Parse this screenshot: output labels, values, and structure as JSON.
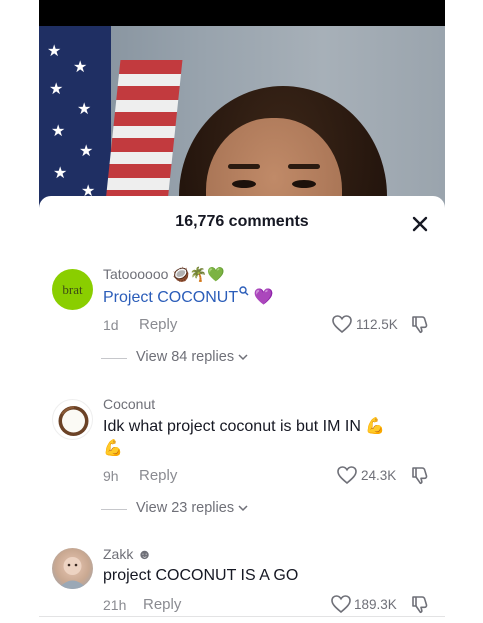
{
  "sheet": {
    "title": "16,776 comments"
  },
  "comments": [
    {
      "username": "Tatoooooo",
      "username_emoji": "🥥🌴💚",
      "text": "Project COCONUT",
      "text_suffix": "💜",
      "avatar_text": "brat",
      "age": "1d",
      "reply_label": "Reply",
      "likes": "112.5K",
      "view_replies": "View 84 replies"
    },
    {
      "username": "Coconut",
      "text_line1": "Idk what project coconut is but IM IN 💪",
      "text_line2": "💪",
      "age": "9h",
      "reply_label": "Reply",
      "likes": "24.3K",
      "view_replies": "View 23 replies"
    },
    {
      "username": "Zakk",
      "username_badge": "☻",
      "text": "project COCONUT IS A GO",
      "age": "21h",
      "reply_label": "Reply",
      "likes": "189.3K"
    }
  ],
  "colors": {
    "link": "#2b5db9",
    "brat_green": "#8ace00",
    "text": "#161823",
    "muted": "#8a8b91"
  }
}
